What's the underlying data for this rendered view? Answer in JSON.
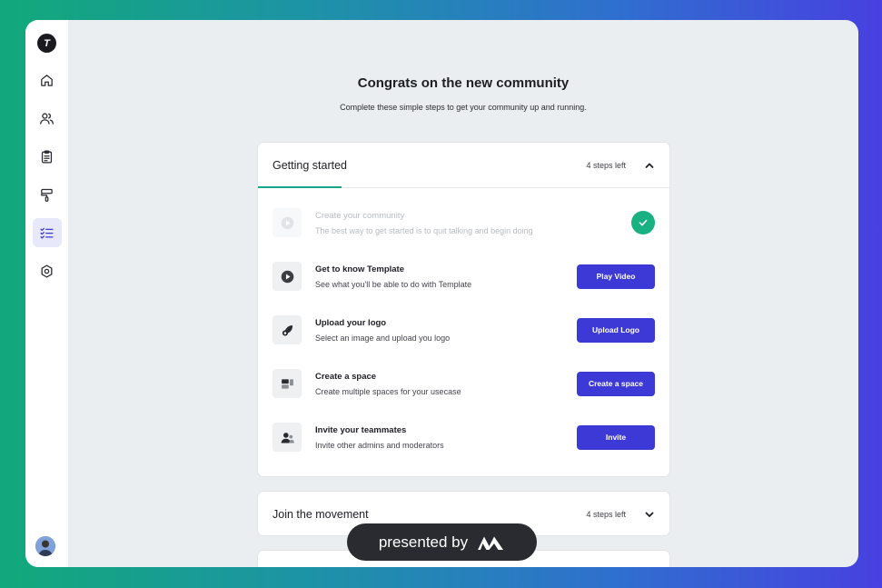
{
  "sidebar": {
    "logo_letter": "T",
    "items": [
      {
        "icon": "home-icon"
      },
      {
        "icon": "users-icon"
      },
      {
        "icon": "clipboard-icon"
      },
      {
        "icon": "paint-roller-icon"
      },
      {
        "icon": "checklist-icon",
        "active": true
      },
      {
        "icon": "settings-icon"
      }
    ]
  },
  "page": {
    "title": "Congrats on the new community",
    "subtitle": "Complete these simple steps to get your community up and running."
  },
  "getting_started": {
    "title": "Getting started",
    "steps_left": "4 steps left",
    "steps": [
      {
        "title": "Create your community",
        "desc": "The best way to get started is to quit talking and begin doing",
        "done": true
      },
      {
        "title": "Get to know Template",
        "desc": "See what you'll be able to do with Template",
        "button": "Play Video"
      },
      {
        "title": "Upload your logo",
        "desc": "Select an image and upload you logo",
        "button": "Upload Logo"
      },
      {
        "title": "Create a space",
        "desc": "Create multiple spaces for your usecase",
        "button": "Create a space"
      },
      {
        "title": "Invite your teammates",
        "desc": "Invite other admins and moderators",
        "button": "Invite"
      }
    ]
  },
  "join_movement": {
    "title": "Join the movement",
    "steps_left": "4 steps left"
  },
  "badge": {
    "text": "presented by"
  },
  "colors": {
    "accent": "#3d39d6",
    "success": "#19b082",
    "tab_underline": "#14a88a"
  }
}
